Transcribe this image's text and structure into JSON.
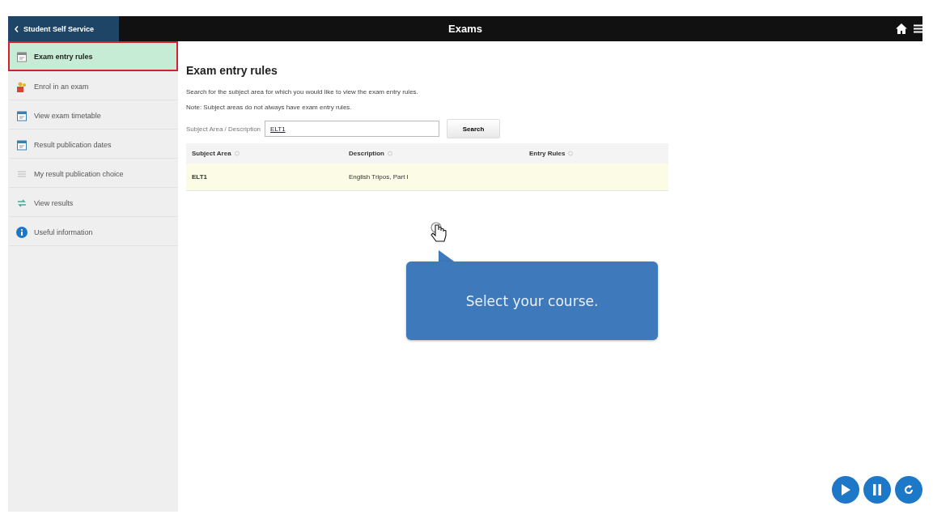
{
  "header": {
    "back_label": "Student Self Service",
    "title": "Exams"
  },
  "sidebar": {
    "items": [
      {
        "label": "Exam entry rules",
        "kind": "document",
        "selected": true
      },
      {
        "label": "Enrol in an exam",
        "kind": "people",
        "selected": false
      },
      {
        "label": "View exam timetable",
        "kind": "timetable",
        "selected": false
      },
      {
        "label": "Result publication dates",
        "kind": "calendar",
        "selected": false
      },
      {
        "label": "My result publication choice",
        "kind": "list",
        "selected": false
      },
      {
        "label": "View results",
        "kind": "arrows",
        "selected": false
      },
      {
        "label": "Useful information",
        "kind": "info",
        "selected": false
      }
    ]
  },
  "content": {
    "heading": "Exam entry rules",
    "intro": "Search for the subject area for which you would like to view the exam entry rules.",
    "note": "Note: Subject areas do not always have exam entry rules.",
    "search": {
      "label": "Subject Area / Description",
      "value": "ELT1",
      "button": "Search"
    },
    "table": {
      "columns": [
        "Subject Area",
        "Description",
        "Entry Rules"
      ],
      "rows": [
        {
          "cells": [
            "ELT1",
            "English Tripos, Part I",
            ""
          ],
          "selected": true
        }
      ]
    }
  },
  "callout": {
    "text": "Select your course."
  },
  "player": {
    "buttons": [
      {
        "kind": "play"
      },
      {
        "kind": "pause"
      },
      {
        "kind": "replay"
      }
    ]
  }
}
